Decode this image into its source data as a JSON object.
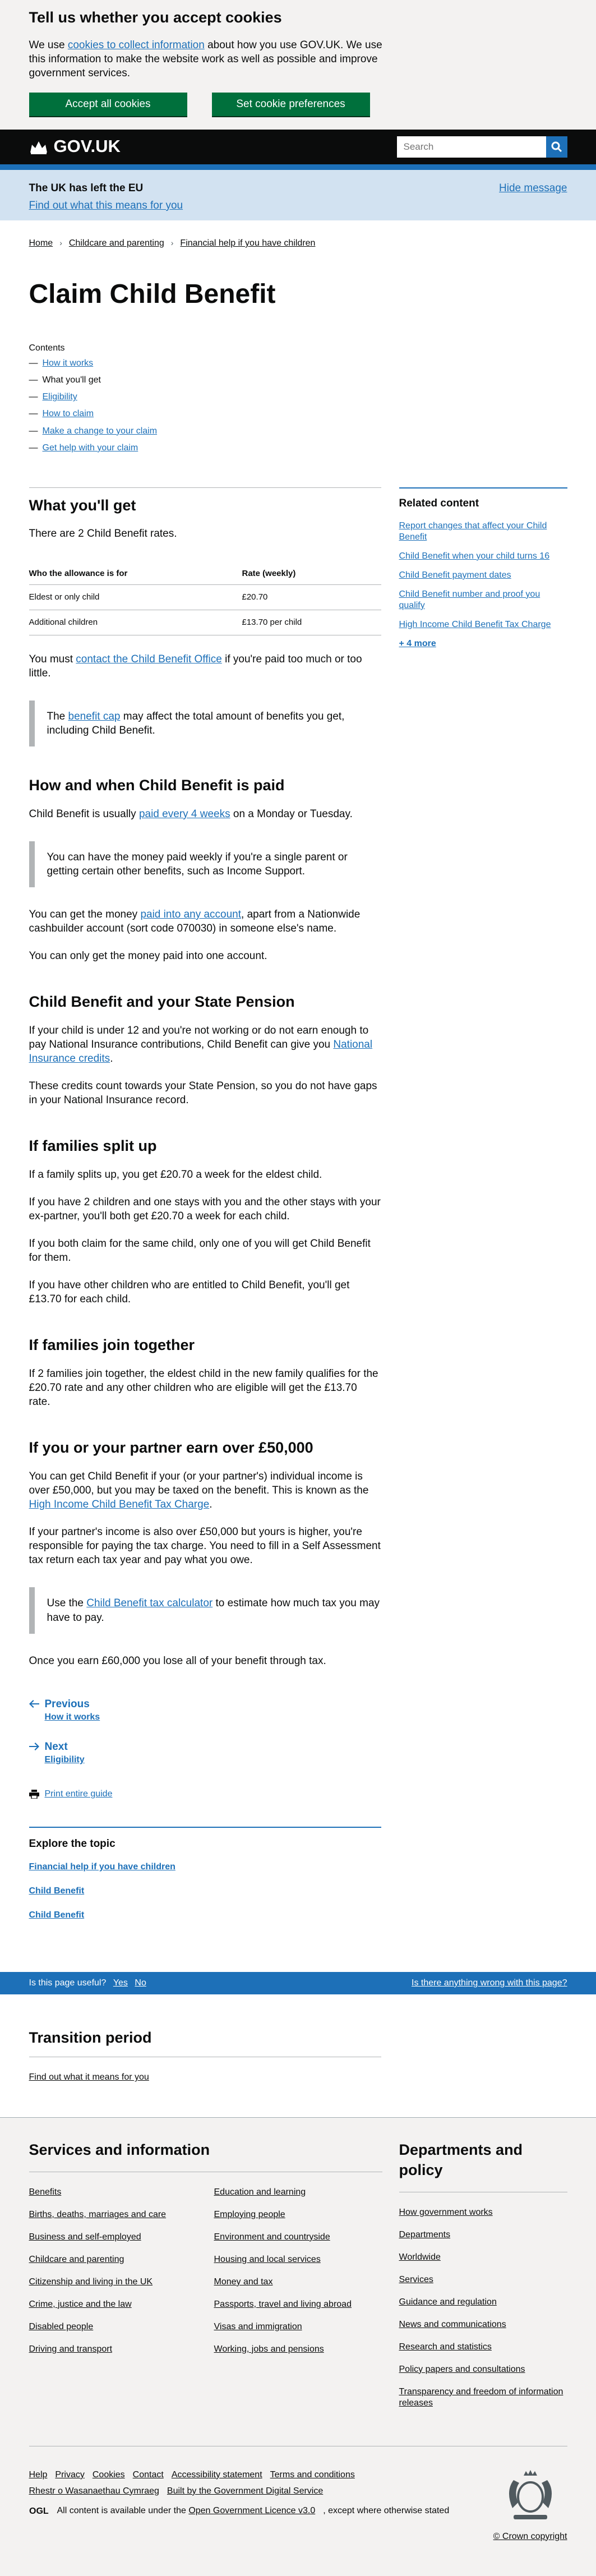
{
  "cookie": {
    "title": "Tell us whether you accept cookies",
    "text_before": "We use ",
    "link": "cookies to collect information",
    "text_after": " about how you use GOV.UK. We use this information to make the website work as well as possible and improve government services.",
    "accept_label": "Accept all cookies",
    "prefs_label": "Set cookie preferences"
  },
  "header": {
    "logo": "GOV.UK",
    "search_placeholder": "Search"
  },
  "eu": {
    "title": "The UK has left the EU",
    "link": "Find out what this means for you",
    "hide": "Hide message"
  },
  "breadcrumbs": [
    "Home",
    "Childcare and parenting",
    "Financial help if you have children"
  ],
  "title": "Claim Child Benefit",
  "contents": {
    "heading": "Contents",
    "items": [
      {
        "label": "How it works",
        "link": true
      },
      {
        "label": "What you'll get",
        "link": false
      },
      {
        "label": "Eligibility",
        "link": true
      },
      {
        "label": "How to claim",
        "link": true
      },
      {
        "label": "Make a change to your claim",
        "link": true
      },
      {
        "label": "Get help with your claim",
        "link": true
      }
    ]
  },
  "related": {
    "heading": "Related content",
    "items": [
      "Report changes that affect your Child Benefit",
      "Child Benefit when your child turns 16",
      "Child Benefit payment dates",
      "Child Benefit number and proof you qualify",
      "High Income Child Benefit Tax Charge"
    ],
    "more": "+ 4 more"
  },
  "s1": {
    "heading": "What you'll get",
    "intro": "There are 2 Child Benefit rates.",
    "table": {
      "col1": "Who the allowance is for",
      "col2": "Rate (weekly)",
      "rows": [
        {
          "who": "Eldest or only child",
          "rate": "£20.70"
        },
        {
          "who": "Additional children",
          "rate": "£13.70 per child"
        }
      ]
    },
    "p_before": "You must ",
    "p_link": "contact the Child Benefit Office",
    "p_after": " if you're paid too much or too little.",
    "inset_before": "The ",
    "inset_link": "benefit cap",
    "inset_after": " may affect the total amount of benefits you get, including Child Benefit."
  },
  "s2": {
    "heading": "How and when Child Benefit is paid",
    "p1_before": "Child Benefit is usually ",
    "p1_link": "paid every 4 weeks",
    "p1_after": " on a Monday or Tuesday.",
    "inset": "You can have the money paid weekly if you're a single parent or getting certain other benefits, such as Income Support.",
    "p2_before": "You can get the money ",
    "p2_link": "paid into any account",
    "p2_after": ", apart from a Nationwide cashbuilder account (sort code 070030) in someone else's name.",
    "p3": "You can only get the money paid into one account."
  },
  "s3": {
    "heading": "Child Benefit and your State Pension",
    "p1_before": "If your child is under 12 and you're not working or do not earn enough to pay National Insurance contributions, Child Benefit can give you ",
    "p1_link": "National Insurance credits",
    "p1_after": ".",
    "p2": "These credits count towards your State Pension, so you do not have gaps in your National Insurance record."
  },
  "s4": {
    "heading": "If families split up",
    "p1": "If a family splits up, you get £20.70 a week for the eldest child.",
    "p2": "If you have 2 children and one stays with you and the other stays with your ex-partner, you'll both get £20.70 a week for each child.",
    "p3": "If you both claim for the same child, only one of you will get Child Benefit for them.",
    "p4": "If you have other children who are entitled to Child Benefit, you'll get £13.70 for each child."
  },
  "s5": {
    "heading": "If families join together",
    "p1": "If 2 families join together, the eldest child in the new family qualifies for the £20.70 rate and any other children who are eligible will get the £13.70 rate."
  },
  "s6": {
    "heading": "If you or your partner earn over £50,000",
    "p1_before": "You can get Child Benefit if your (or your partner's) individual income is over £50,000, but you may be taxed on the benefit. This is known as the ",
    "p1_link": "High Income Child Benefit Tax Charge",
    "p1_after": ".",
    "p2": "If your partner's income is also over £50,000 but yours is higher, you're responsible for paying the tax charge. You need to fill in a Self Assessment tax return each tax year and pay what you owe.",
    "inset_before": "Use the ",
    "inset_link": "Child Benefit tax calculator",
    "inset_after": " to estimate how much tax you may have to pay.",
    "p3": "Once you earn £60,000 you lose all of your benefit through tax."
  },
  "pn": {
    "prev": "Previous",
    "prev_sub": "How it works",
    "next": "Next",
    "next_sub": "Eligibility",
    "print": "Print entire guide"
  },
  "explore": {
    "heading": "Explore the topic",
    "items": [
      "Financial help if you have children",
      "Child Benefit",
      "Child Benefit"
    ]
  },
  "useful": {
    "q": "Is this page useful?",
    "yes": "Yes",
    "no": "No",
    "wrong": "Is there anything wrong with this page?"
  },
  "transition": {
    "heading": "Transition period",
    "link": "Find out what it means for you"
  },
  "footer": {
    "services_heading": "Services and information",
    "services_col1": [
      "Benefits",
      "Births, deaths, marriages and care",
      "Business and self-employed",
      "Childcare and parenting",
      "Citizenship and living in the UK",
      "Crime, justice and the law",
      "Disabled people",
      "Driving and transport"
    ],
    "services_col2": [
      "Education and learning",
      "Employing people",
      "Environment and countryside",
      "Housing and local services",
      "Money and tax",
      "Passports, travel and living abroad",
      "Visas and immigration",
      "Working, jobs and pensions"
    ],
    "dept_heading": "Departments and policy",
    "dept": [
      "How government works",
      "Departments",
      "Worldwide",
      "Services",
      "Guidance and regulation",
      "News and communications",
      "Research and statistics",
      "Policy papers and consultations",
      "Transparency and freedom of information releases"
    ],
    "links_row1": [
      "Help",
      "Privacy",
      "Cookies",
      "Contact",
      "Accessibility statement",
      "Terms and conditions"
    ],
    "links_row2": [
      "Rhestr o Wasanaethau Cymraeg",
      "Built by the Government Digital Service"
    ],
    "ogl": "OGL",
    "licence_before": "All content is available under the ",
    "licence_link": "Open Government Licence v3.0",
    "licence_after": ", except where otherwise stated",
    "copyright": "© Crown copyright"
  }
}
